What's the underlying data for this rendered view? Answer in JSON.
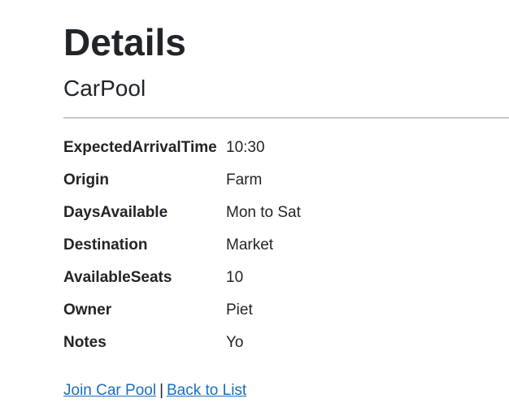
{
  "page": {
    "title": "Details",
    "subtitle": "CarPool"
  },
  "details": [
    {
      "label": "ExpectedArrivalTime",
      "value": "10:30"
    },
    {
      "label": "Origin",
      "value": "Farm"
    },
    {
      "label": "DaysAvailable",
      "value": "Mon to Sat"
    },
    {
      "label": "Destination",
      "value": "Market"
    },
    {
      "label": "AvailableSeats",
      "value": "10"
    },
    {
      "label": "Owner",
      "value": "Piet"
    },
    {
      "label": "Notes",
      "value": "Yo"
    }
  ],
  "actions": {
    "join_label": "Join Car Pool",
    "separator": "|",
    "back_label": "Back to List"
  },
  "colors": {
    "link": "#1b6ec2",
    "text": "#212529",
    "divider": "#c8c8c8"
  }
}
